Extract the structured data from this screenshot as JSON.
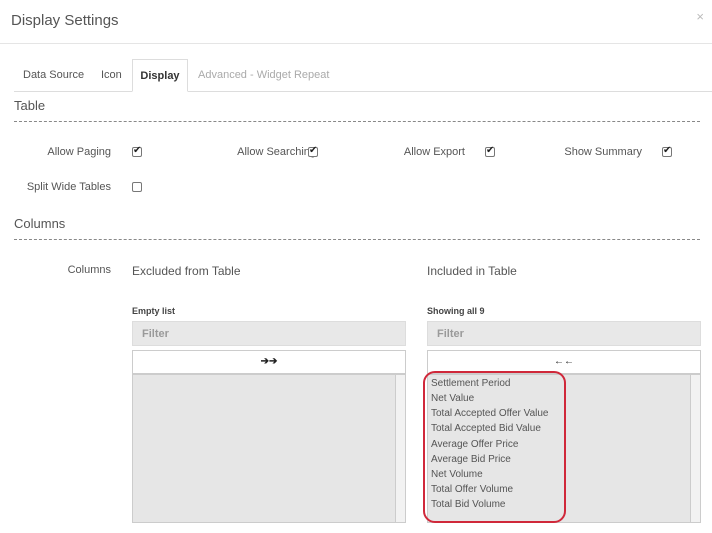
{
  "dialog": {
    "title": "Display Settings",
    "close_icon": "close-icon",
    "close_glyph": "×"
  },
  "tabs": [
    {
      "label": "Data Source",
      "state": "normal"
    },
    {
      "label": "Icon",
      "state": "normal"
    },
    {
      "label": "Display",
      "state": "active"
    },
    {
      "label": "Advanced - Widget Repeat",
      "state": "disabled"
    }
  ],
  "table_section": {
    "title": "Table",
    "options": [
      {
        "label": "Allow Paging",
        "checked": true
      },
      {
        "label": "Allow Searching",
        "checked": true
      },
      {
        "label": "Allow Export",
        "checked": true
      },
      {
        "label": "Show Summary",
        "checked": true
      },
      {
        "label": "Split Wide Tables",
        "checked": false
      }
    ]
  },
  "columns_section": {
    "title": "Columns",
    "label": "Columns",
    "excluded": {
      "title": "Excluded from Table",
      "info": "Empty list",
      "filter_placeholder": "Filter",
      "move_glyph": "➔➔",
      "items": []
    },
    "included": {
      "title": "Included in Table",
      "info": "Showing all 9",
      "filter_placeholder": "Filter",
      "move_glyph": "←←",
      "items": [
        "Settlement Period",
        "Net Value",
        "Total Accepted Offer Value",
        "Total Accepted Bid Value",
        "Average Offer Price",
        "Average Bid Price",
        "Net Volume",
        "Total Offer Volume",
        "Total Bid Volume"
      ]
    }
  },
  "check_glyph": "✔",
  "highlight_color": "#d0283a"
}
